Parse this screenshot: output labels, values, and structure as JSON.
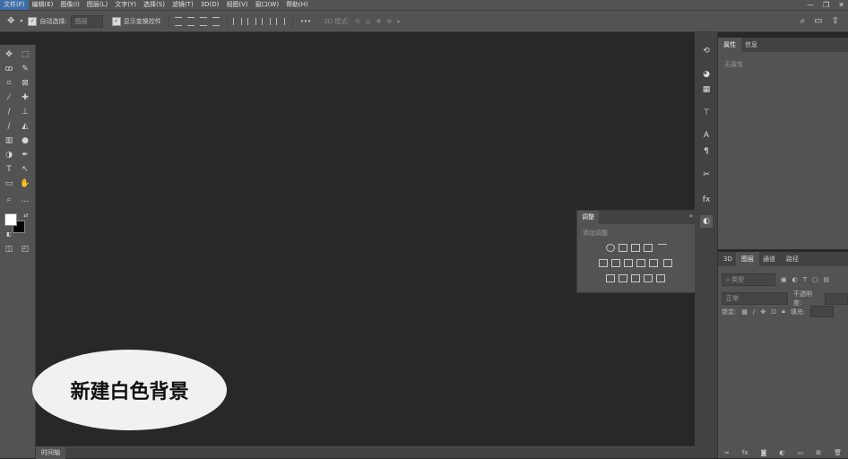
{
  "menu": {
    "items": [
      "文件(F)",
      "编辑(E)",
      "图像(I)",
      "图层(L)",
      "文字(Y)",
      "选择(S)",
      "滤镜(T)",
      "3D(D)",
      "视图(V)",
      "窗口(W)",
      "帮助(H)"
    ]
  },
  "window": {
    "minimize": "—",
    "restore": "❐",
    "close": "✕"
  },
  "options": {
    "auto_select_label": "自动选择:",
    "auto_select_value": "图层",
    "show_transform_label": "显示变换控件",
    "more": "•••",
    "mode_3d_label": "3D 模式:"
  },
  "timeline": {
    "tab": "时间轴"
  },
  "caption": {
    "text": "新建白色背景"
  },
  "adjustments": {
    "tab": "调整",
    "collapse": "»",
    "subtitle": "添加调整"
  },
  "properties": {
    "tabs": [
      "属性",
      "信息"
    ],
    "empty": "无属性"
  },
  "layers": {
    "tabs": [
      "3D",
      "图层",
      "通道",
      "路径"
    ],
    "filter_kind": "类型",
    "blend_mode": "正常",
    "opacity_label": "不透明度:",
    "lock_label": "锁定:",
    "fill_label": "填充:",
    "footer_fx": "fx"
  },
  "colors": {
    "foreground": "#ffffff",
    "background": "#000000",
    "accent": "#3d6fa8"
  }
}
